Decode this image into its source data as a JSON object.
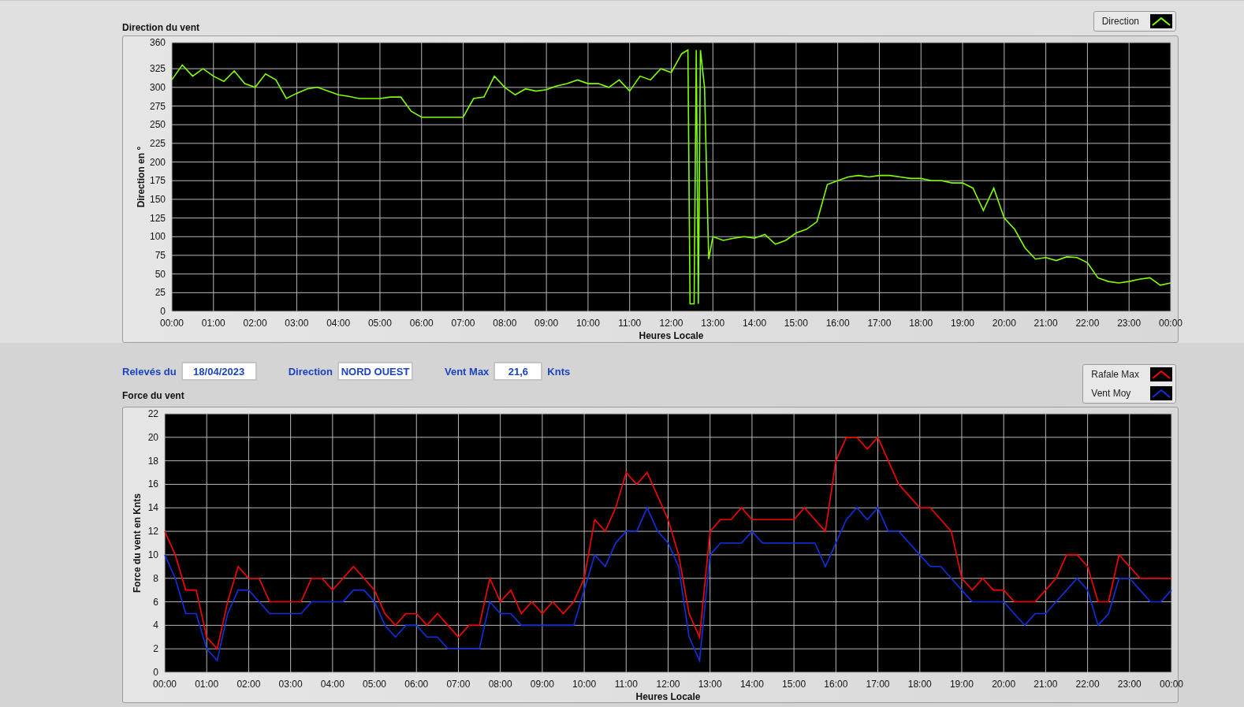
{
  "direction_chart": {
    "chart_data": {
      "type": "line",
      "title": "Direction du vent",
      "xlabel": "Heures Locale",
      "ylabel": "Direction en °",
      "xlim": [
        0,
        24
      ],
      "ylim": [
        0,
        360
      ],
      "grid": true,
      "yticks": [
        0,
        25,
        50,
        75,
        100,
        125,
        150,
        175,
        200,
        225,
        250,
        275,
        300,
        325,
        360
      ],
      "xticks": [
        {
          "value": 0,
          "label": "00:00"
        },
        {
          "value": 1,
          "label": "01:00"
        },
        {
          "value": 2,
          "label": "02:00"
        },
        {
          "value": 3,
          "label": "03:00"
        },
        {
          "value": 4,
          "label": "04:00"
        },
        {
          "value": 5,
          "label": "05:00"
        },
        {
          "value": 6,
          "label": "06:00"
        },
        {
          "value": 7,
          "label": "07:00"
        },
        {
          "value": 8,
          "label": "08:00"
        },
        {
          "value": 9,
          "label": "09:00"
        },
        {
          "value": 10,
          "label": "10:00"
        },
        {
          "value": 11,
          "label": "11:00"
        },
        {
          "value": 12,
          "label": "12:00"
        },
        {
          "value": 13,
          "label": "13:00"
        },
        {
          "value": 14,
          "label": "14:00"
        },
        {
          "value": 15,
          "label": "15:00"
        },
        {
          "value": 16,
          "label": "16:00"
        },
        {
          "value": 17,
          "label": "17:00"
        },
        {
          "value": 18,
          "label": "18:00"
        },
        {
          "value": 19,
          "label": "19:00"
        },
        {
          "value": 20,
          "label": "20:00"
        },
        {
          "value": 21,
          "label": "21:00"
        },
        {
          "value": 22,
          "label": "22:00"
        },
        {
          "value": 23,
          "label": "23:00"
        },
        {
          "value": 24,
          "label": "00:00"
        }
      ],
      "x": [
        0,
        0.25,
        0.5,
        0.75,
        1,
        1.25,
        1.5,
        1.75,
        2,
        2.25,
        2.5,
        2.75,
        3,
        3.25,
        3.5,
        3.75,
        4,
        4.25,
        4.5,
        4.75,
        5,
        5.25,
        5.5,
        5.75,
        6,
        6.25,
        6.5,
        6.75,
        7,
        7.25,
        7.5,
        7.75,
        8,
        8.25,
        8.5,
        8.75,
        9,
        9.25,
        9.5,
        9.75,
        10,
        10.25,
        10.5,
        10.75,
        11,
        11.25,
        11.5,
        11.75,
        12,
        12.25,
        12.4,
        12.45,
        12.55,
        12.6,
        12.65,
        12.7,
        12.8,
        12.9,
        13,
        13.25,
        13.5,
        13.75,
        14,
        14.25,
        14.5,
        14.75,
        15,
        15.25,
        15.5,
        15.75,
        16,
        16.25,
        16.5,
        16.75,
        17,
        17.25,
        17.5,
        17.75,
        18,
        18.25,
        18.5,
        18.75,
        19,
        19.25,
        19.5,
        19.75,
        20,
        20.25,
        20.5,
        20.75,
        21,
        21.25,
        21.5,
        21.75,
        22,
        22.25,
        22.5,
        22.75,
        23,
        23.25,
        23.5,
        23.75,
        24
      ],
      "series": [
        {
          "name": "Direction",
          "color": "#80ff00",
          "values": [
            310,
            330,
            315,
            325,
            315,
            308,
            322,
            305,
            300,
            318,
            310,
            285,
            292,
            298,
            300,
            295,
            290,
            288,
            285,
            285,
            285,
            287,
            287,
            268,
            260,
            260,
            260,
            260,
            260,
            285,
            287,
            315,
            300,
            290,
            298,
            295,
            297,
            302,
            305,
            310,
            305,
            305,
            300,
            310,
            295,
            315,
            310,
            325,
            320,
            345,
            350,
            10,
            10,
            350,
            10,
            350,
            300,
            70,
            100,
            95,
            98,
            100,
            98,
            103,
            90,
            95,
            105,
            110,
            120,
            170,
            175,
            180,
            182,
            180,
            182,
            182,
            180,
            178,
            178,
            175,
            175,
            172,
            172,
            165,
            135,
            165,
            125,
            110,
            85,
            70,
            72,
            68,
            73,
            72,
            65,
            45,
            40,
            38,
            40,
            43,
            45,
            35,
            38
          ]
        }
      ]
    }
  },
  "readings": {
    "date_label": "Relevés du",
    "date": "18/04/2023",
    "direction_label": "Direction",
    "direction": "NORD OUEST",
    "max_label": "Vent Max",
    "max": "21,6",
    "unit": "Knts"
  },
  "force_chart": {
    "chart_data": {
      "type": "line",
      "title": "Force du vent",
      "xlabel": "Heures Locale",
      "ylabel": "Force du vent en Knts",
      "xlim": [
        0,
        24
      ],
      "ylim": [
        0,
        22
      ],
      "grid": true,
      "yticks": [
        0,
        2,
        4,
        6,
        8,
        10,
        12,
        14,
        16,
        18,
        20,
        22
      ],
      "xticks": [
        {
          "value": 0,
          "label": "00:00"
        },
        {
          "value": 1,
          "label": "01:00"
        },
        {
          "value": 2,
          "label": "02:00"
        },
        {
          "value": 3,
          "label": "03:00"
        },
        {
          "value": 4,
          "label": "04:00"
        },
        {
          "value": 5,
          "label": "05:00"
        },
        {
          "value": 6,
          "label": "06:00"
        },
        {
          "value": 7,
          "label": "07:00"
        },
        {
          "value": 8,
          "label": "08:00"
        },
        {
          "value": 9,
          "label": "09:00"
        },
        {
          "value": 10,
          "label": "10:00"
        },
        {
          "value": 11,
          "label": "11:00"
        },
        {
          "value": 12,
          "label": "12:00"
        },
        {
          "value": 13,
          "label": "13:00"
        },
        {
          "value": 14,
          "label": "14:00"
        },
        {
          "value": 15,
          "label": "15:00"
        },
        {
          "value": 16,
          "label": "16:00"
        },
        {
          "value": 17,
          "label": "17:00"
        },
        {
          "value": 18,
          "label": "18:00"
        },
        {
          "value": 19,
          "label": "19:00"
        },
        {
          "value": 20,
          "label": "20:00"
        },
        {
          "value": 21,
          "label": "21:00"
        },
        {
          "value": 22,
          "label": "22:00"
        },
        {
          "value": 23,
          "label": "23:00"
        },
        {
          "value": 24,
          "label": "00:00"
        }
      ],
      "x": [
        0,
        0.25,
        0.5,
        0.75,
        1,
        1.25,
        1.5,
        1.75,
        2,
        2.25,
        2.5,
        2.75,
        3,
        3.25,
        3.5,
        3.75,
        4,
        4.25,
        4.5,
        4.75,
        5,
        5.25,
        5.5,
        5.75,
        6,
        6.25,
        6.5,
        6.75,
        7,
        7.25,
        7.5,
        7.75,
        8,
        8.25,
        8.5,
        8.75,
        9,
        9.25,
        9.5,
        9.75,
        10,
        10.25,
        10.5,
        10.75,
        11,
        11.25,
        11.5,
        11.75,
        12,
        12.25,
        12.5,
        12.75,
        13,
        13.25,
        13.5,
        13.75,
        14,
        14.25,
        14.5,
        14.75,
        15,
        15.25,
        15.5,
        15.75,
        16,
        16.25,
        16.5,
        16.75,
        17,
        17.25,
        17.5,
        17.75,
        18,
        18.25,
        18.5,
        18.75,
        19,
        19.25,
        19.5,
        19.75,
        20,
        20.25,
        20.5,
        20.75,
        21,
        21.25,
        21.5,
        21.75,
        22,
        22.25,
        22.5,
        22.75,
        23,
        23.25,
        23.5,
        23.75,
        24
      ],
      "series": [
        {
          "name": "Rafale Max",
          "color": "#ff0000",
          "values": [
            12,
            10,
            7,
            7,
            3,
            2,
            6,
            9,
            8,
            8,
            6,
            6,
            6,
            6,
            8,
            8,
            7,
            8,
            9,
            8,
            7,
            5,
            4,
            5,
            5,
            4,
            5,
            4,
            3,
            4,
            4,
            8,
            6,
            7,
            5,
            6,
            5,
            6,
            5,
            6,
            8,
            13,
            12,
            14,
            17,
            16,
            17,
            15,
            13,
            10,
            5,
            3,
            12,
            13,
            13,
            14,
            13,
            13,
            13,
            13,
            13,
            14,
            13,
            12,
            18,
            20,
            20,
            19,
            20,
            18,
            16,
            15,
            14,
            14,
            13,
            12,
            8,
            7,
            8,
            7,
            7,
            6,
            6,
            6,
            7,
            8,
            10,
            10,
            9,
            6,
            6,
            10,
            9,
            8,
            8,
            8,
            8
          ]
        },
        {
          "name": "Vent Moy",
          "color": "#1030e0",
          "values": [
            10,
            8,
            5,
            5,
            2,
            1,
            5,
            7,
            7,
            6,
            5,
            5,
            5,
            5,
            6,
            6,
            6,
            6,
            7,
            7,
            6,
            4,
            3,
            4,
            4,
            3,
            3,
            2,
            2,
            2,
            2,
            6,
            5,
            5,
            4,
            4,
            4,
            4,
            4,
            4,
            7,
            10,
            9,
            11,
            12,
            12,
            14,
            12,
            11,
            9,
            3,
            1,
            10,
            11,
            11,
            11,
            12,
            11,
            11,
            11,
            11,
            11,
            11,
            9,
            11,
            13,
            14,
            13,
            14,
            12,
            12,
            11,
            10,
            9,
            9,
            8,
            7,
            6,
            6,
            6,
            6,
            5,
            4,
            5,
            5,
            6,
            7,
            8,
            7,
            4,
            5,
            8,
            8,
            7,
            6,
            6,
            7
          ]
        }
      ]
    }
  }
}
